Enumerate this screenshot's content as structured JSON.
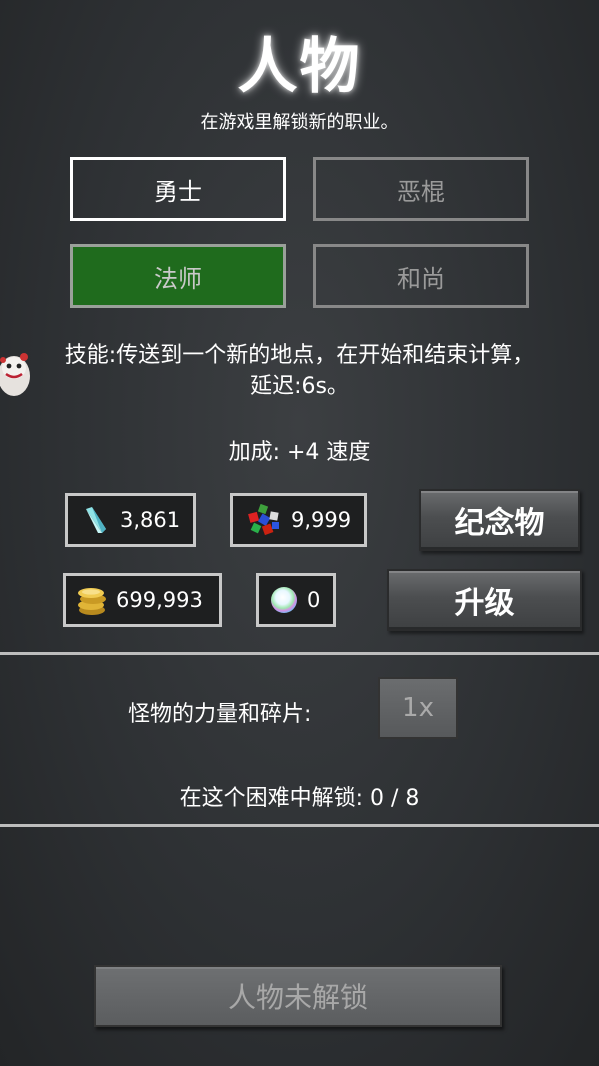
{
  "header": {
    "title": "人物",
    "subtitle": "在游戏里解锁新的职业。"
  },
  "classes": [
    {
      "label": "勇士",
      "state": "selected"
    },
    {
      "label": "恶棍",
      "state": "normal"
    },
    {
      "label": "法师",
      "state": "highlighted"
    },
    {
      "label": "和尚",
      "state": "normal"
    }
  ],
  "skill_text_line1": "技能:传送到一个新的地点，在开始和结束计算，",
  "skill_text_line2": "延迟:6s。",
  "bonus_text": "加成: +4 速度",
  "resources": {
    "crystal": "3,861",
    "gems": "9,999",
    "gold": "699,993",
    "orb": "0"
  },
  "buttons": {
    "souvenir": "纪念物",
    "upgrade": "升级",
    "multiplier": "1x",
    "locked": "人物未解锁"
  },
  "monster_label": "怪物的力量和碎片:",
  "unlock_info": "在这个困难中解锁: 0 / 8",
  "colors": {
    "highlight_green": "#1f6b1d",
    "background": "#2e3134"
  }
}
